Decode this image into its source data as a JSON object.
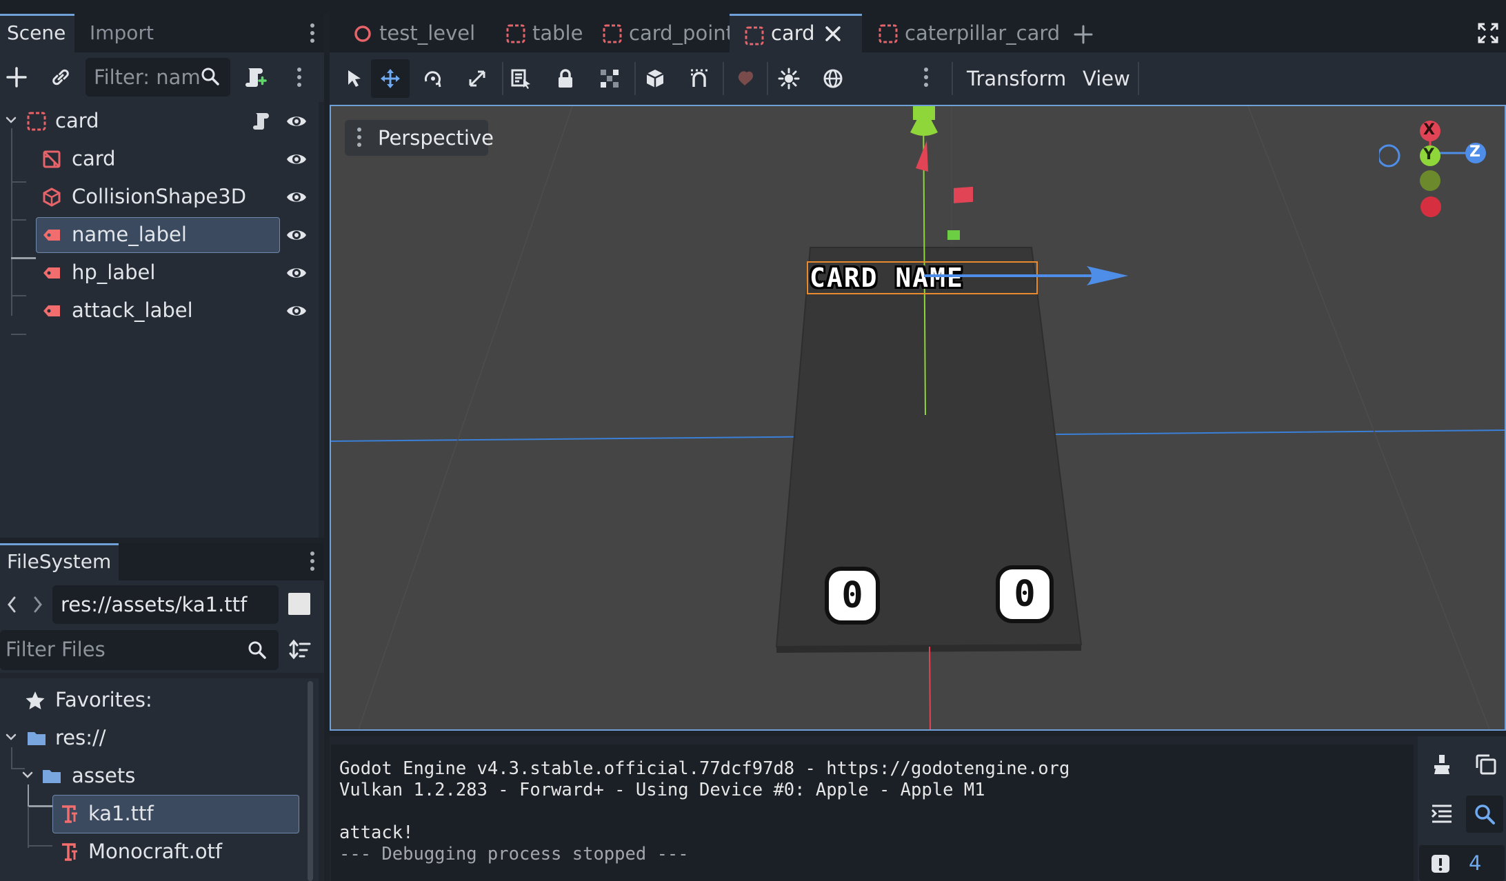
{
  "scene_dock": {
    "tabs": [
      "Scene",
      "Import"
    ],
    "filter_placeholder": "Filter: nam",
    "tree": [
      {
        "label": "card",
        "type": "root"
      },
      {
        "label": "card",
        "type": "mesh"
      },
      {
        "label": "CollisionShape3D",
        "type": "collision"
      },
      {
        "label": "name_label",
        "type": "label",
        "selected": true
      },
      {
        "label": "hp_label",
        "type": "label"
      },
      {
        "label": "attack_label",
        "type": "label"
      }
    ]
  },
  "filesystem": {
    "tab": "FileSystem",
    "path": "res://assets/ka1.ttf",
    "filter_placeholder": "Filter Files",
    "items": [
      {
        "label": "Favorites:",
        "type": "favorites"
      },
      {
        "label": "res://",
        "type": "folder"
      },
      {
        "label": "assets",
        "type": "folder"
      },
      {
        "label": "ka1.ttf",
        "type": "font",
        "selected": true
      },
      {
        "label": "Monocraft.otf",
        "type": "font"
      }
    ]
  },
  "scene_tabs": [
    {
      "label": "test_level",
      "icon": "circle-scene-icon"
    },
    {
      "label": "table",
      "icon": "scene-icon"
    },
    {
      "label": "card_point",
      "icon": "scene-icon"
    },
    {
      "label": "card",
      "icon": "scene-icon",
      "active": true
    },
    {
      "label": "caterpillar_card",
      "icon": "scene-icon"
    }
  ],
  "viewport_toolbar": {
    "transform_menu": "Transform",
    "view_menu": "View"
  },
  "viewport": {
    "perspective_label": "Perspective",
    "card_name_text": "CARD NAME",
    "hp_value": "0",
    "attack_value": "0",
    "gizmo_axes": {
      "x": "X",
      "y": "Y",
      "z": "Z"
    }
  },
  "output": {
    "lines": [
      "Godot Engine v4.3.stable.official.77dcf97d8 - https://godotengine.org",
      "Vulkan 1.2.283 - Forward+ - Using Device #0: Apple - Apple M1",
      "",
      "attack!",
      "--- Debugging process stopped ---"
    ],
    "warning_count": "4"
  },
  "colors": {
    "accent": "#70a0d8",
    "node_red": "#e7636a",
    "label_red": "#f26d6d",
    "axis_x": "#e14455",
    "axis_y": "#8fd63a",
    "axis_z": "#4f8ee8"
  }
}
